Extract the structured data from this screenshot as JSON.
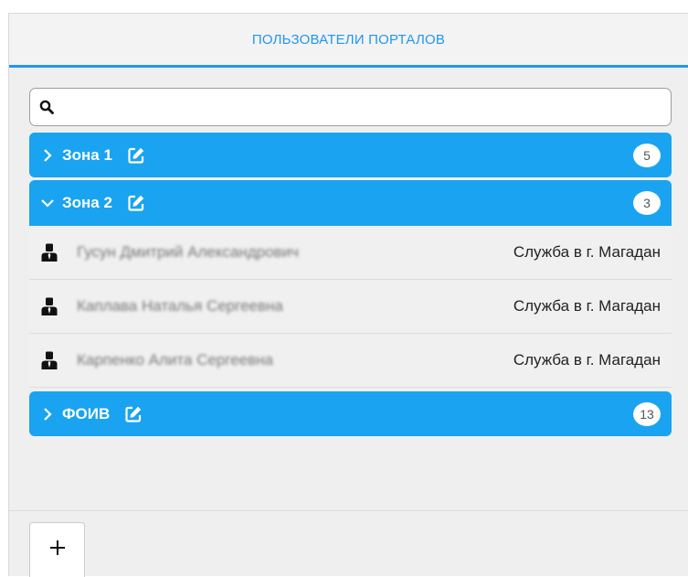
{
  "header": {
    "title": "ПОЛЬЗОВАТЕЛИ ПОРТАЛОВ"
  },
  "search": {
    "value": "",
    "placeholder": "",
    "icon": "search-icon"
  },
  "colors": {
    "accent": "#2196f3",
    "group_bg": "#1aa3f0",
    "panel_bg": "#efefef"
  },
  "groups": [
    {
      "name": "Зона 1",
      "count": "5",
      "expanded": false
    },
    {
      "name": "Зона 2",
      "count": "3",
      "expanded": true,
      "users": [
        {
          "name": "Гусун Дмитрий Александрович",
          "org": "Служба в г. Магадан"
        },
        {
          "name": "Каплава Наталья Сергеевна",
          "org": "Служба в г. Магадан"
        },
        {
          "name": "Карпенко Алита Сергеевна",
          "org": "Служба в г. Магадан"
        }
      ]
    },
    {
      "name": "ФОИВ",
      "count": "13",
      "expanded": false
    }
  ],
  "footer": {
    "add_label": "+"
  }
}
